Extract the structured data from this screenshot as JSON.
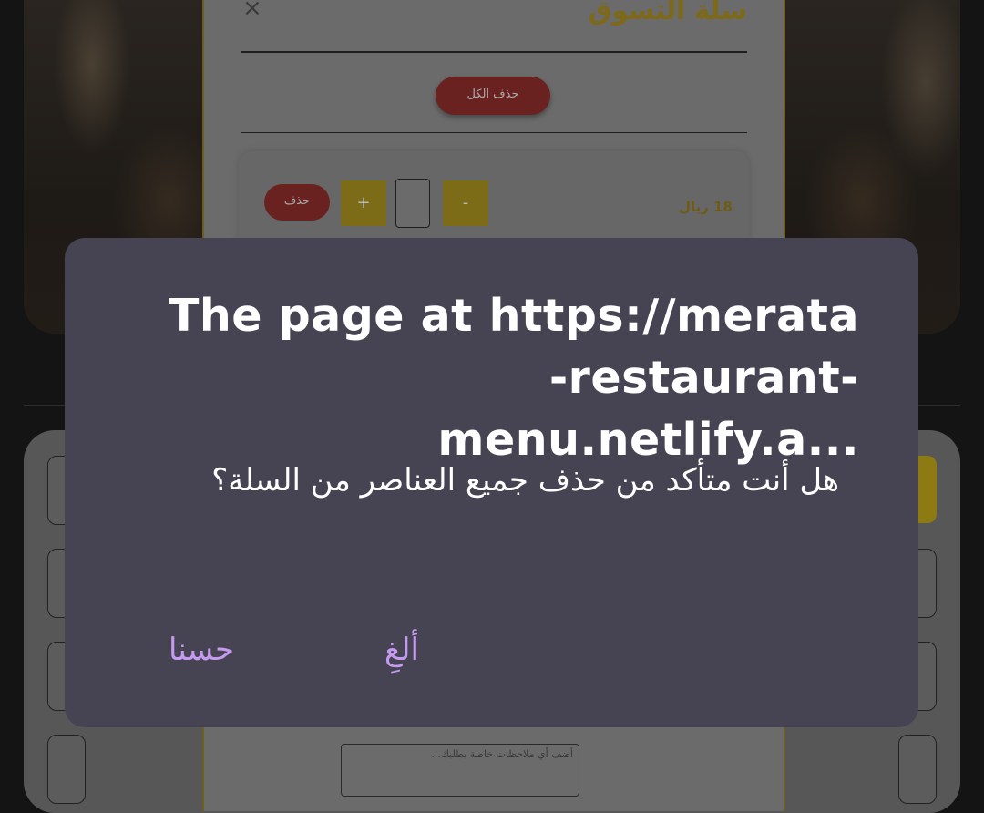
{
  "background": {
    "cart": {
      "title": "سلة التسوق",
      "close_icon": "×",
      "clear_all_label": "حذف الكل",
      "item": {
        "name": "",
        "price": "18 ريال",
        "minus_label": "-",
        "plus_label": "+",
        "quantity": "",
        "delete_label": "حذف"
      },
      "notes_placeholder": "أضف أي ملاحظات خاصة بطلبك..."
    }
  },
  "dialog": {
    "title_line1": "The page at https://merata",
    "title_line2": "-restaurant-menu.netlify.a...",
    "message": "هل أنت متأكد من حذف جميع العناصر من السلة؟",
    "cancel_label": "ألغِ",
    "ok_label": "حسنا",
    "accent_color": "#c59bf0",
    "background_color": "#464452"
  }
}
